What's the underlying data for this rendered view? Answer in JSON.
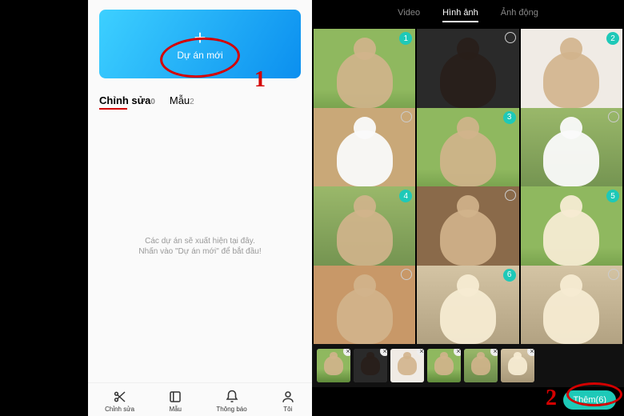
{
  "left": {
    "new_project_label": "Dự án mới",
    "tabs": [
      {
        "label": "Chỉnh sửa",
        "count": "0"
      },
      {
        "label": "Mẫu",
        "count": "2"
      }
    ],
    "empty_line1": "Các dự án sẽ xuất hiện tại đây.",
    "empty_line2": "Nhấn vào \"Dự án mới\" để bắt đầu!",
    "nav": [
      {
        "label": "Chỉnh sửa"
      },
      {
        "label": "Mẫu"
      },
      {
        "label": "Thông báo"
      },
      {
        "label": "Tôi"
      }
    ]
  },
  "right": {
    "tabs": [
      {
        "label": "Video",
        "active": false
      },
      {
        "label": "Hình ảnh",
        "active": true
      },
      {
        "label": "Ảnh động",
        "active": false
      }
    ],
    "grid_badges": [
      "1",
      "",
      "2",
      "",
      "3",
      "",
      "4",
      "",
      "5",
      "",
      "6",
      ""
    ],
    "add_button_label": "Thêm(6)"
  },
  "steps": {
    "one": "1",
    "two": "2"
  }
}
